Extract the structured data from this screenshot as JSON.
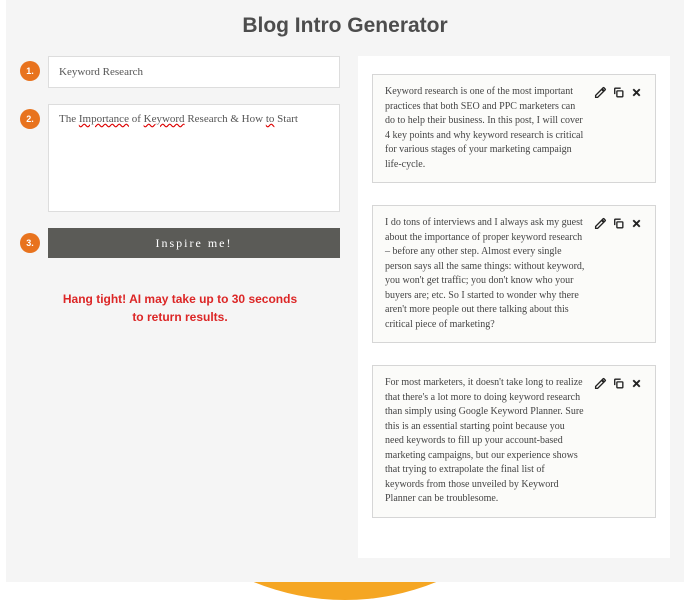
{
  "title": "Blog Intro Generator",
  "form": {
    "step1": "1.",
    "step2": "2.",
    "step3": "3.",
    "keyword_value": "Keyword Research",
    "topic_parts": {
      "p1": "The ",
      "u1": "Importance",
      "p2": " of ",
      "u2": "Keyword",
      "p3": " Research & How ",
      "u3": "to",
      "p4": " Start"
    },
    "button_label": "Inspire me!",
    "wait_line1": "Hang tight! AI may take up to 30 seconds",
    "wait_line2": "to return results."
  },
  "results": [
    {
      "text": "Keyword research is one of the most important practices that both SEO and PPC marketers can do to help their business. In this post, I will cover 4 key points and why keyword research is critical for various stages of your marketing campaign life-cycle."
    },
    {
      "text": "I do tons of interviews and I always ask my guest about the importance of proper keyword research – before any other step. Almost every single person says all the same things: without keyword, you won't get traffic; you don't know who your buyers are; etc. So I started to wonder why there aren't more people out there talking about this critical piece of marketing?"
    },
    {
      "text": "For most marketers, it doesn't take long to realize that there's a lot more to doing keyword research than simply using Google Keyword Planner. Sure this is an essential starting point because you need keywords to fill up your account-based marketing campaigns, but our experience shows that trying to extrapolate the final list of keywords from those unveiled by Keyword Planner can be troublesome."
    }
  ]
}
